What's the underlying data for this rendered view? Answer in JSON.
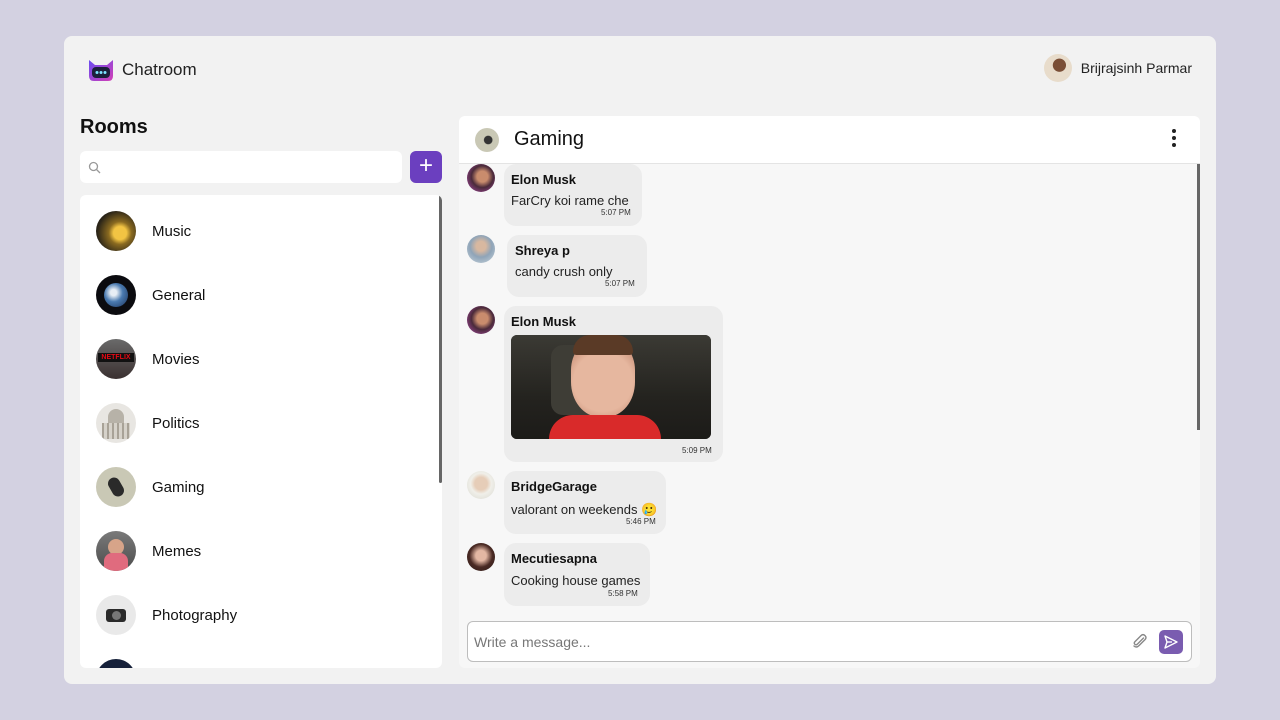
{
  "app": {
    "name": "Chatroom"
  },
  "user": {
    "name": "Brijrajsinh Parmar"
  },
  "rooms_panel": {
    "title": "Rooms",
    "search_placeholder": "",
    "add_label": "+",
    "items": [
      {
        "label": "Music",
        "icon": "music-room-avatar"
      },
      {
        "label": "General",
        "icon": "earth-avatar"
      },
      {
        "label": "Movies",
        "icon": "netflix-avatar",
        "badge": "NETFLIX"
      },
      {
        "label": "Politics",
        "icon": "capitol-avatar"
      },
      {
        "label": "Gaming",
        "icon": "gaming-avatar"
      },
      {
        "label": "Memes",
        "icon": "memes-avatar"
      },
      {
        "label": "Photography",
        "icon": "camera-avatar"
      }
    ]
  },
  "chat": {
    "room_name": "Gaming",
    "messages": [
      {
        "sender": "Elon Musk",
        "text": "FarCry koi rame che",
        "time": "5:07 PM"
      },
      {
        "sender": "Shreya p",
        "text": "candy crush only",
        "time": "5:07 PM"
      },
      {
        "sender": "Elon Musk",
        "text": "",
        "time": "5:09 PM",
        "image": "kid-smiling-photo"
      },
      {
        "sender": "BridgeGarage",
        "text": "valorant on weekends 🥲",
        "time": "5:46 PM"
      },
      {
        "sender": "Mecutiesapna",
        "text": "Cooking house games",
        "time": "5:58 PM"
      }
    ],
    "composer": {
      "placeholder": "Write a message...",
      "value": ""
    }
  },
  "colors": {
    "accent": "#6b3fbf",
    "send": "#7a5cb0",
    "background": "#d3d1e1",
    "bubble": "#ececec"
  }
}
